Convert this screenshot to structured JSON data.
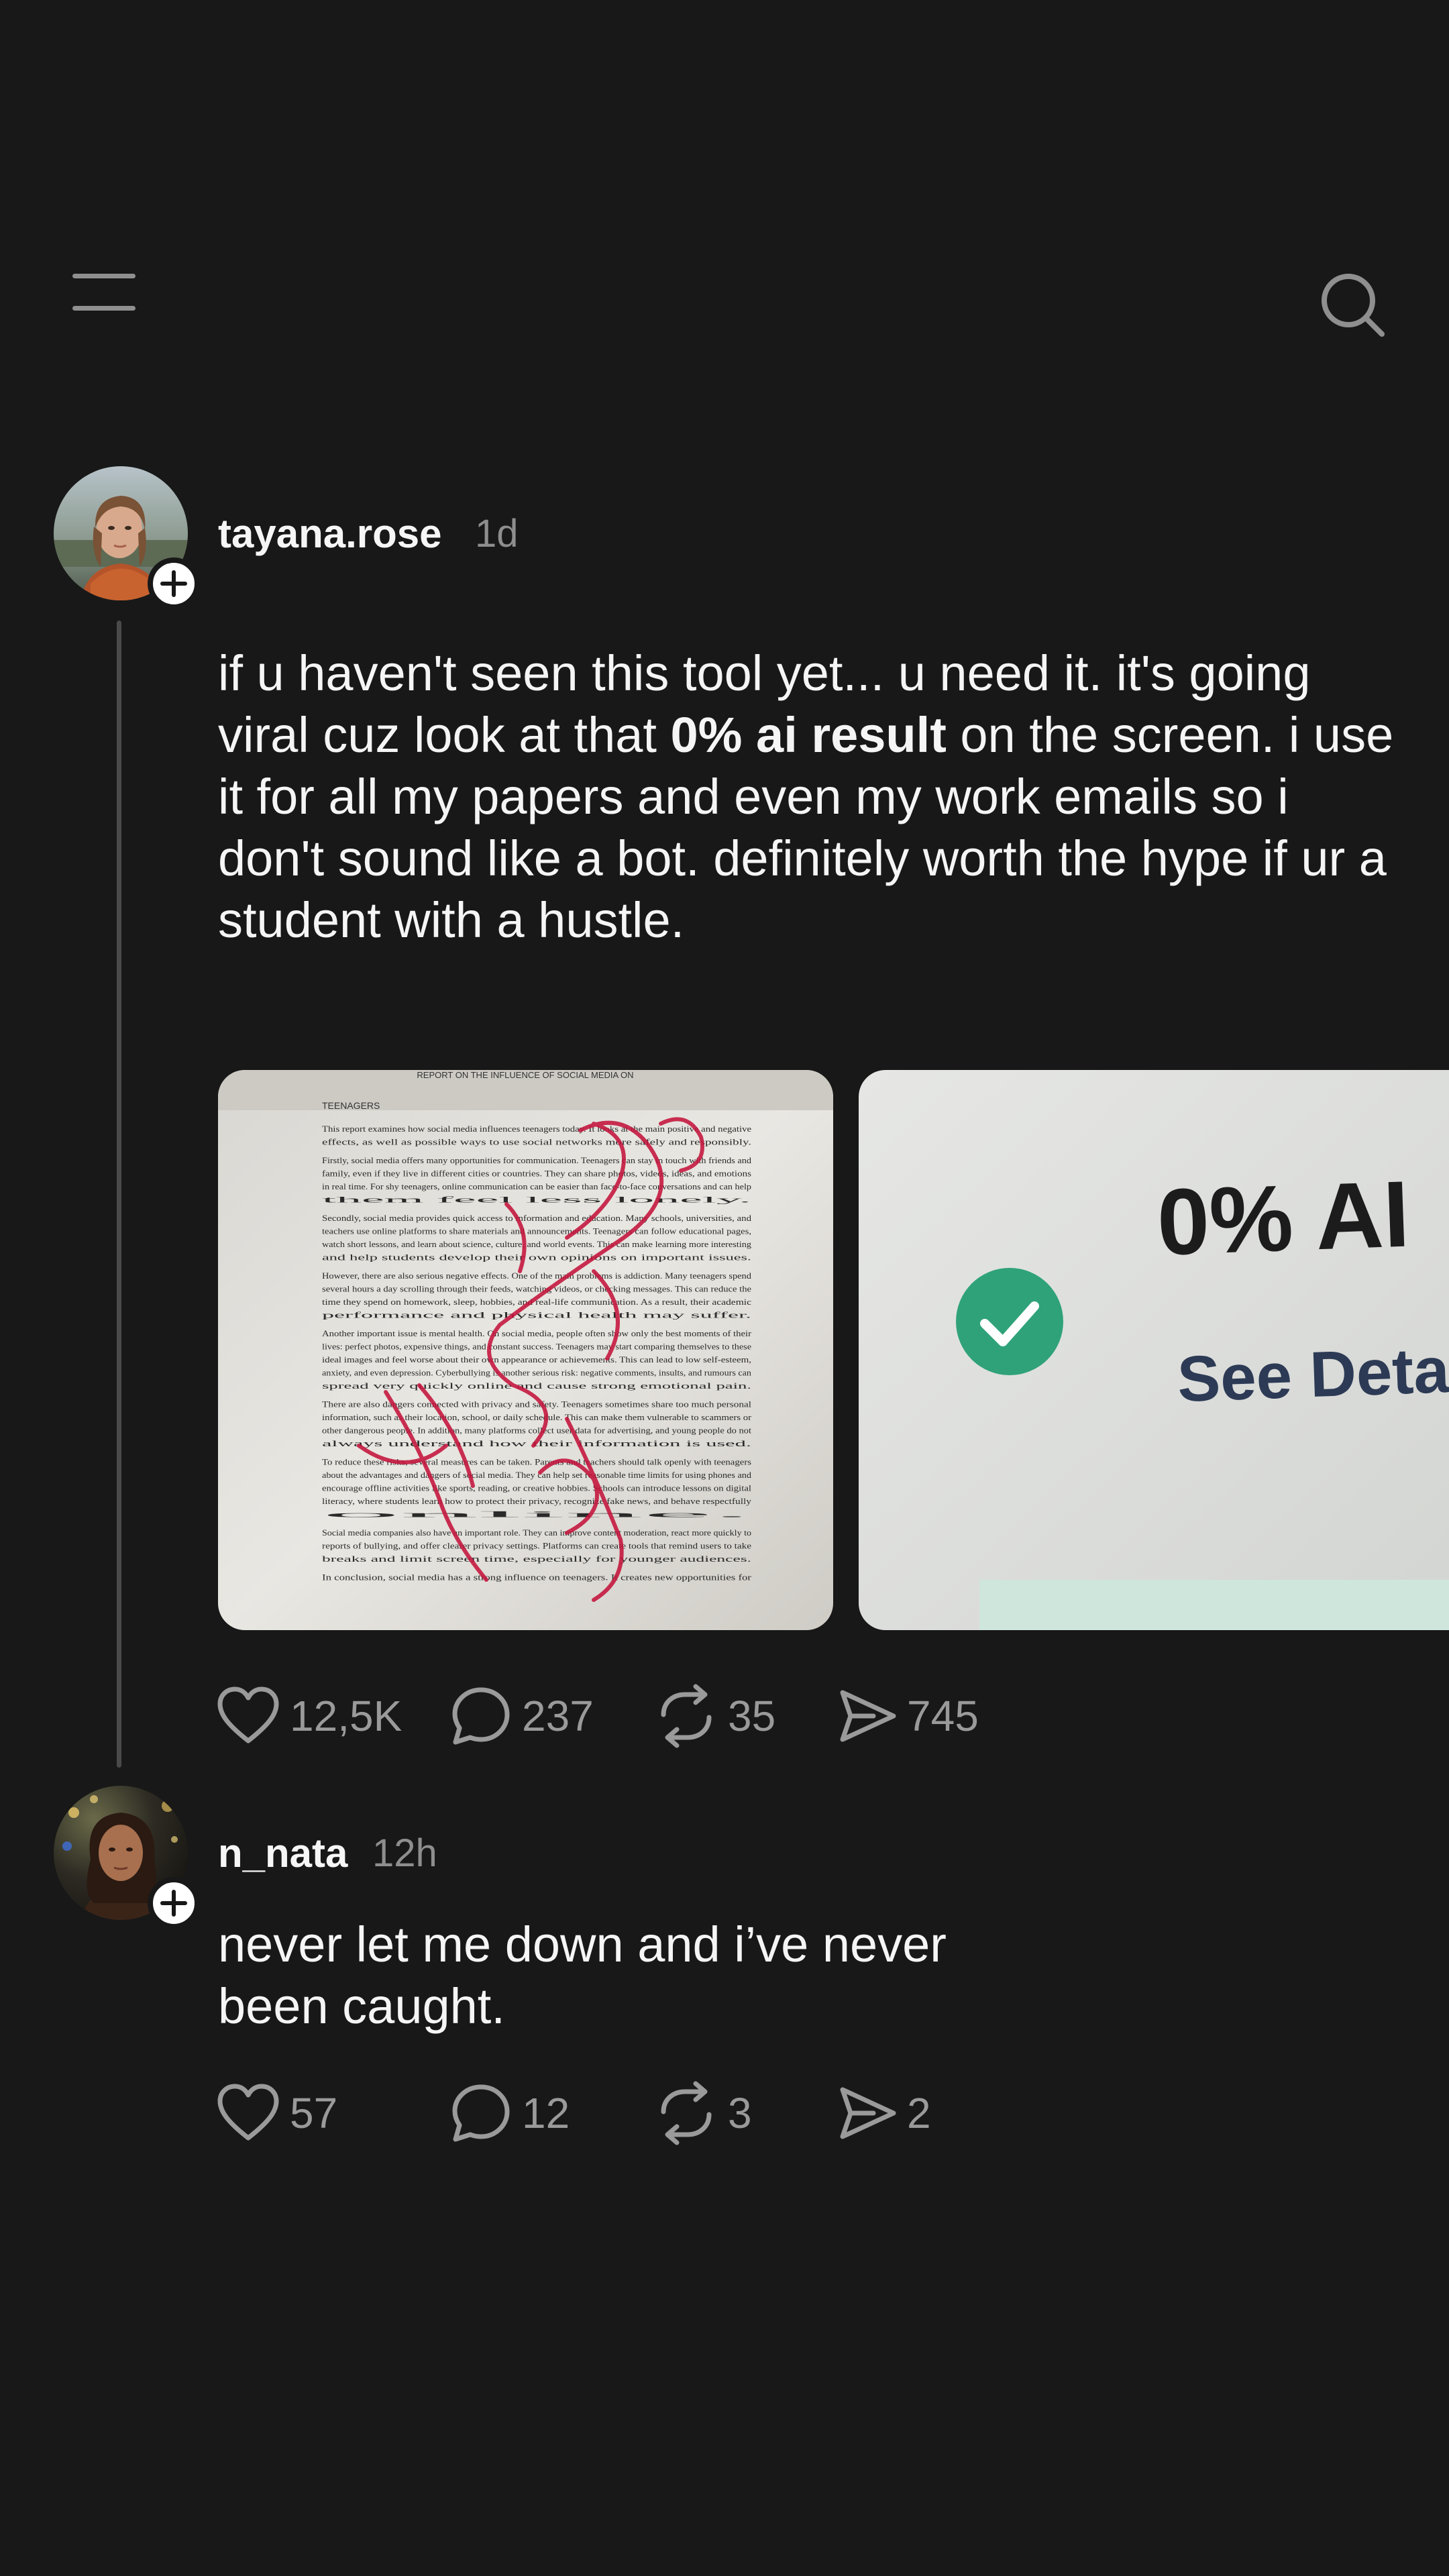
{
  "posts": [
    {
      "username": "tayana.rose",
      "time": "1d",
      "body_before": "if u haven't seen this tool yet... u need it. it's going viral cuz look at that ",
      "body_bold": "0% ai result",
      "body_after": " on the screen. i use it for all my papers and even my work emails so i don't sound like a bot. definitely worth the hype if ur a student with a hustle.",
      "media": {
        "doc_header": "REPORT ON THE INFLUENCE OF SOCIAL MEDIA ON",
        "doc_subheader": "TEENAGERS",
        "doc_paragraphs": [
          "This report examines how social media influences teenagers today. It looks at the main positive and negative effects, as well as possible ways to use social networks more safely and responsibly.",
          "Firstly, social media offers many opportunities for communication. Teenagers can stay in touch with friends and family, even if they live in different cities or countries. They can share photos, videos, ideas, and emotions in real time. For shy teenagers, online communication can be easier than face-to-face conversations and can help them feel less lonely.",
          "Secondly, social media provides quick access to information and education. Many schools, universities, and teachers use online platforms to share materials and announcements. Teenagers can follow educational pages, watch short lessons, and learn about science, culture, and world events. This can make learning more interesting and help students develop their own opinions on important issues.",
          "However, there are also serious negative effects. One of the main problems is addiction. Many teenagers spend several hours a day scrolling through their feeds, watching videos, or checking messages. This can reduce the time they spend on homework, sleep, hobbies, and real-life communication. As a result, their academic performance and physical health may suffer.",
          "Another important issue is mental health. On social media, people often show only the best moments of their lives: perfect photos, expensive things, and constant success. Teenagers may start comparing themselves to these ideal images and feel worse about their own appearance or achievements. This can lead to low self-esteem, anxiety, and even depression. Cyberbullying is another serious risk: negative comments, insults, and rumours can spread very quickly online and cause strong emotional pain.",
          "There are also dangers connected with privacy and safety. Teenagers sometimes share too much personal information, such as their location, school, or daily schedule. This can make them vulnerable to scammers or other dangerous people. In addition, many platforms collect user data for advertising, and young people do not always understand how their information is used.",
          "To reduce these risks, several measures can be taken. Parents and teachers should talk openly with teenagers about the advantages and dangers of social media. They can help set reasonable time limits for using phones and encourage offline activities like sports, reading, or creative hobbies. Schools can introduce lessons on digital literacy, where students learn how to protect their privacy, recognize fake news, and behave respectfully online.",
          "Social media companies also have an important role. They can improve content moderation, react more quickly to reports of bullying, and offer clearer privacy settings. Platforms can create tools that remind users to take breaks and limit screen time, especially for younger audiences.",
          "In conclusion, social media has a strong influence on teenagers. It creates new opportunities for"
        ],
        "result_percent": "0% AI",
        "result_link": "See Deta"
      },
      "actions": {
        "likes": "12,5K",
        "replies": "237",
        "reposts": "35",
        "shares": "745"
      }
    },
    {
      "username": "n_nata",
      "time": "12h",
      "body_line1": "never let me down and i’ve never",
      "body_line2": "been caught.",
      "actions": {
        "likes": "57",
        "replies": "12",
        "reposts": "3",
        "shares": "2"
      }
    }
  ],
  "icons": {
    "menu": "menu-icon",
    "search": "search-icon",
    "like": "heart-icon",
    "reply": "comment-icon",
    "repost": "repost-icon",
    "share": "share-icon",
    "follow": "plus-icon",
    "verified": "check-icon"
  },
  "colors": {
    "background": "#181818",
    "text": "#f3f3f3",
    "muted": "#8e8e8e",
    "thread_line": "#4a4a4a",
    "check_green": "#2fa27a",
    "pen_red": "#c4143c"
  }
}
